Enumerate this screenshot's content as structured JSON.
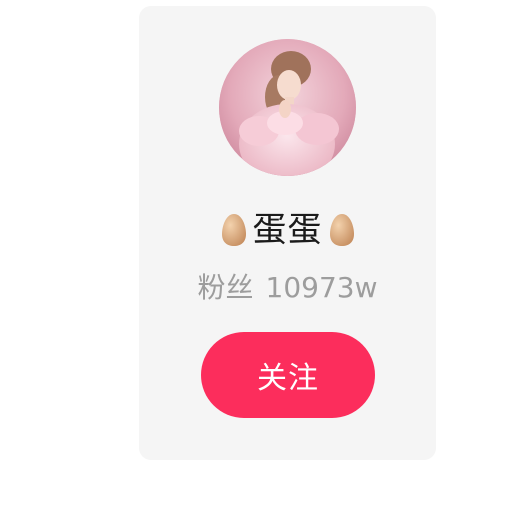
{
  "profile": {
    "name": "蛋蛋",
    "emoji_left": "egg-icon",
    "emoji_right": "egg-icon",
    "fans_label": "粉丝",
    "fans_count": "10973w"
  },
  "actions": {
    "follow_label": "关注"
  },
  "colors": {
    "card_bg": "#f5f5f5",
    "follow_button": "#fc2d5c",
    "fans_text": "#9d9d9d",
    "name_text": "#1b1b1b"
  }
}
